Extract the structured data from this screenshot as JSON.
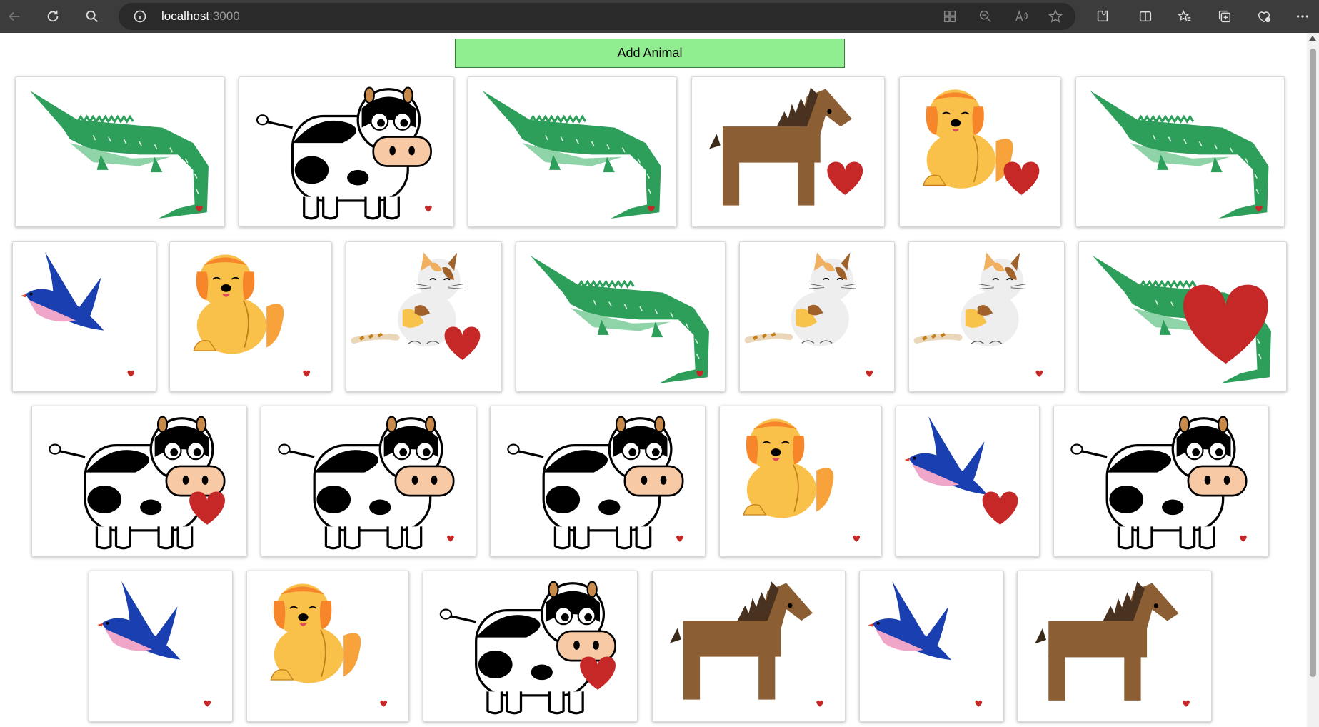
{
  "browser": {
    "url_host": "localhost",
    "url_port": ":3000"
  },
  "toolbar": {
    "add_label": "Add Animal"
  },
  "cards": [
    {
      "animal": "crocodile",
      "heart": "small"
    },
    {
      "animal": "cow",
      "heart": "small"
    },
    {
      "animal": "crocodile",
      "heart": "small"
    },
    {
      "animal": "horse",
      "heart": "medium"
    },
    {
      "animal": "dog",
      "heart": "medium"
    },
    {
      "animal": "crocodile",
      "heart": "small"
    },
    {
      "animal": "bird",
      "heart": "small"
    },
    {
      "animal": "dog",
      "heart": "small"
    },
    {
      "animal": "cat",
      "heart": "medium"
    },
    {
      "animal": "crocodile",
      "heart": "small"
    },
    {
      "animal": "cat",
      "heart": "small"
    },
    {
      "animal": "cat",
      "heart": "small"
    },
    {
      "animal": "crocodile",
      "heart": "large"
    },
    {
      "animal": "cow",
      "heart": "medium"
    },
    {
      "animal": "cow",
      "heart": "small"
    },
    {
      "animal": "cow",
      "heart": "small"
    },
    {
      "animal": "dog",
      "heart": "small"
    },
    {
      "animal": "bird",
      "heart": "medium"
    },
    {
      "animal": "cow",
      "heart": "small"
    },
    {
      "animal": "bird",
      "heart": "small"
    },
    {
      "animal": "dog",
      "heart": "small"
    },
    {
      "animal": "cow",
      "heart": "medium"
    },
    {
      "animal": "horse",
      "heart": "small"
    },
    {
      "animal": "bird",
      "heart": "small"
    },
    {
      "animal": "horse",
      "heart": "small"
    }
  ],
  "colors": {
    "button_bg": "#90ee90",
    "heart": "#c62828",
    "croc": "#2e9e5b",
    "bird": "#1a3fb0",
    "horse": "#8b5e34",
    "dog": "#f9c04a"
  }
}
